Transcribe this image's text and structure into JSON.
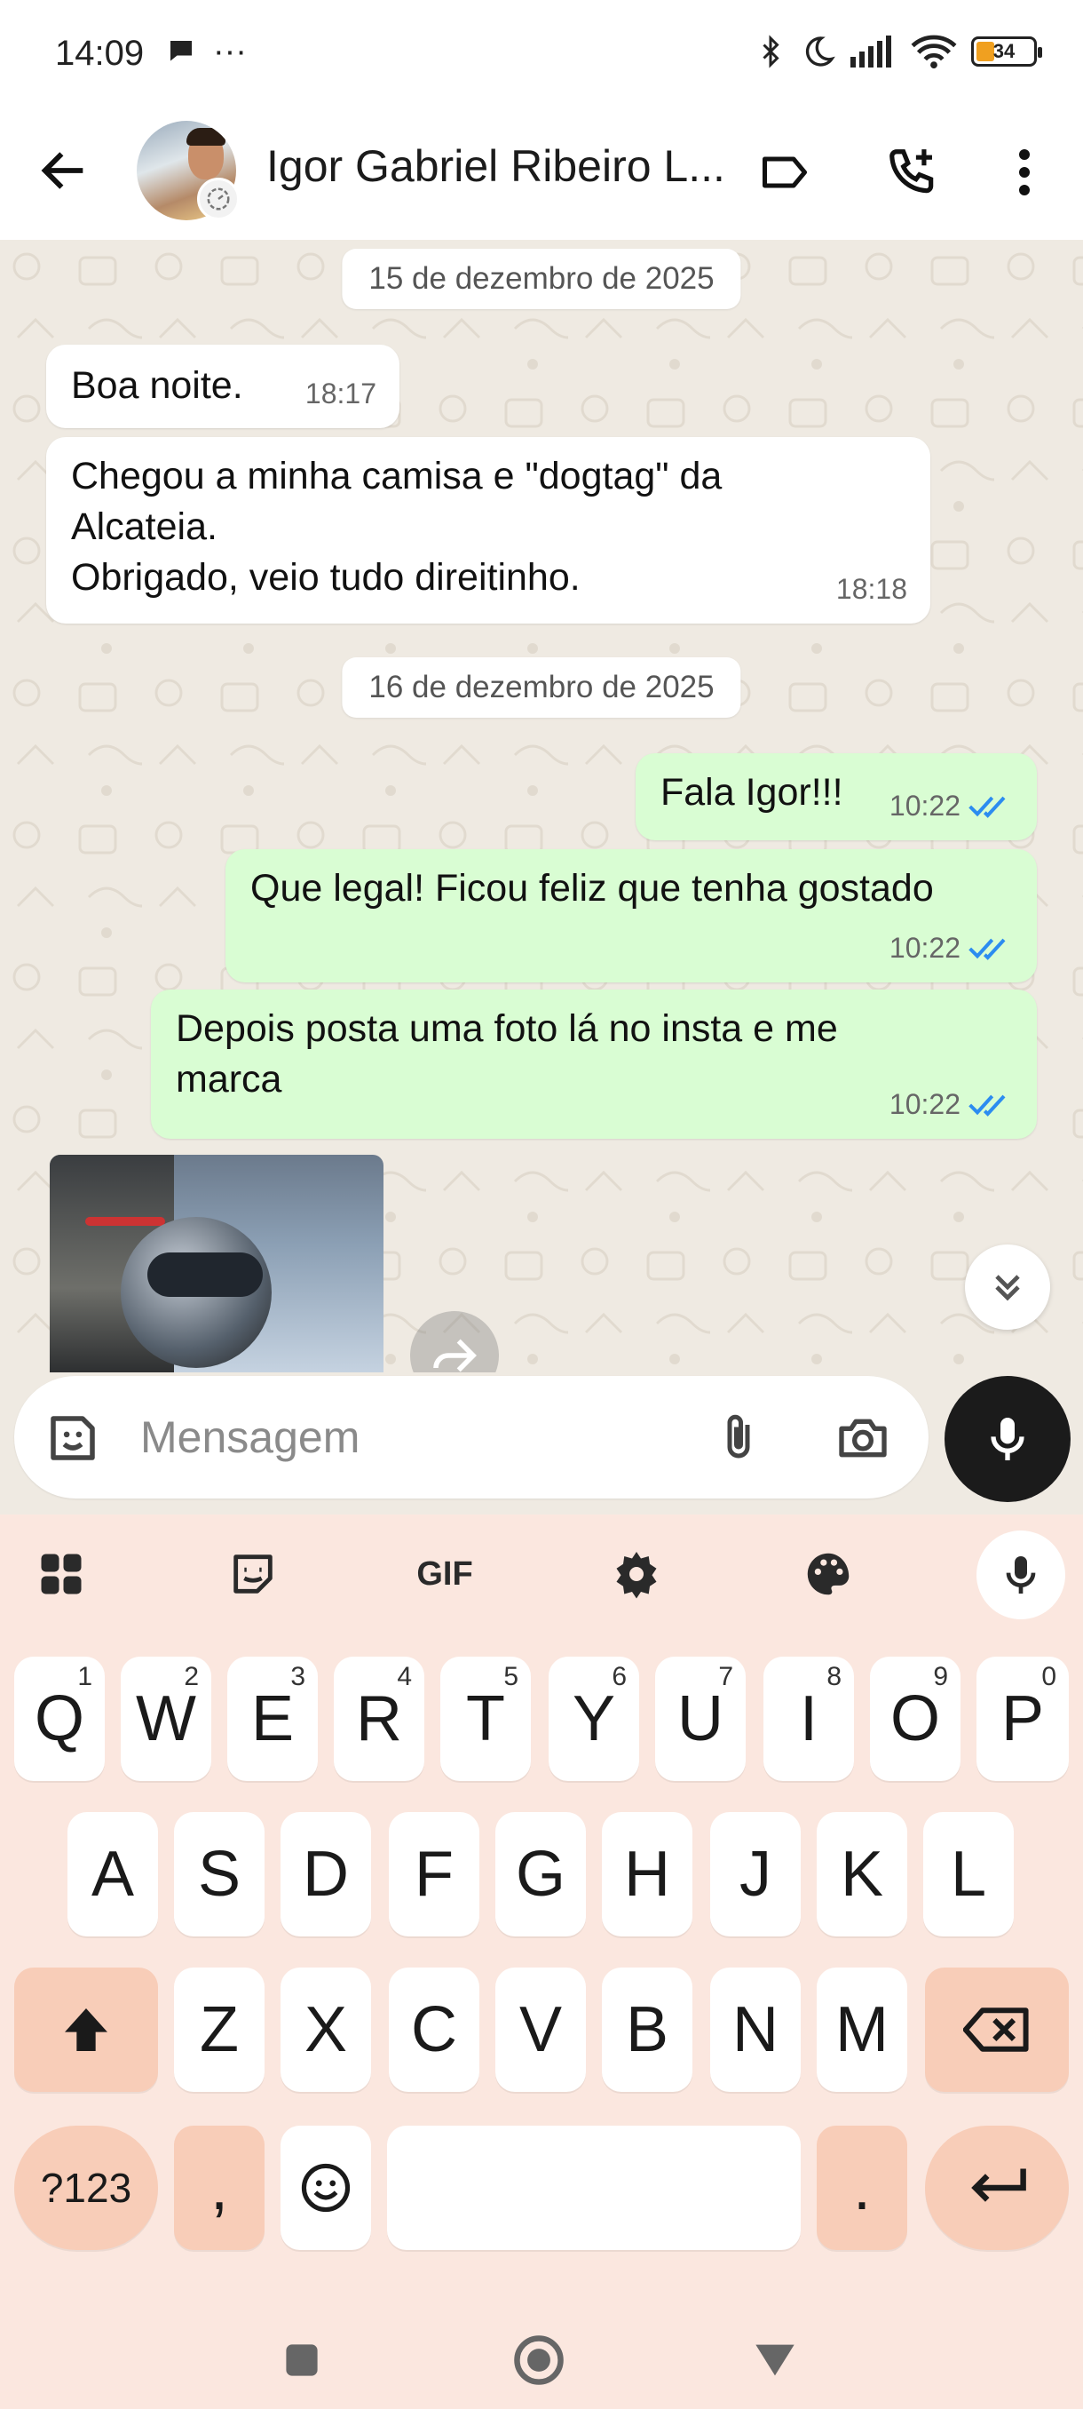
{
  "status_bar": {
    "time": "14:09",
    "more": "···",
    "battery": "34"
  },
  "header": {
    "contact_name": "Igor Gabriel Ribeiro L..."
  },
  "chat": {
    "date_1": "15 de dezembro de 2025",
    "msg_1": {
      "text": "Boa noite.",
      "time": "18:17"
    },
    "msg_2": {
      "text": "Chegou a minha camisa e \"dogtag\" da\nAlcateia.\nObrigado, veio tudo direitinho.",
      "time": "18:18"
    },
    "date_2": "16 de dezembro de 2025",
    "msg_3": {
      "text": "Fala Igor!!!",
      "time": "10:22"
    },
    "msg_4": {
      "text": "Que legal! Ficou feliz que tenha gostado",
      "time": "10:22"
    },
    "msg_5": {
      "text": "Depois posta uma foto lá no insta e me\nmarca",
      "time": "10:22"
    }
  },
  "input": {
    "placeholder": "Mensagem"
  },
  "keyboard": {
    "toolbar_gif": "GIF",
    "row1": [
      {
        "k": "Q",
        "h": "1"
      },
      {
        "k": "W",
        "h": "2"
      },
      {
        "k": "E",
        "h": "3"
      },
      {
        "k": "R",
        "h": "4"
      },
      {
        "k": "T",
        "h": "5"
      },
      {
        "k": "Y",
        "h": "6"
      },
      {
        "k": "U",
        "h": "7"
      },
      {
        "k": "I",
        "h": "8"
      },
      {
        "k": "O",
        "h": "9"
      },
      {
        "k": "P",
        "h": "0"
      }
    ],
    "row2": [
      "A",
      "S",
      "D",
      "F",
      "G",
      "H",
      "J",
      "K",
      "L"
    ],
    "row3": [
      "Z",
      "X",
      "C",
      "V",
      "B",
      "N",
      "M"
    ],
    "symbols": "?123",
    "comma": ",",
    "period": "."
  },
  "colors": {
    "outgoing_bubble": "#d9fdd3",
    "incoming_bubble": "#ffffff",
    "chat_bg": "#efeae2",
    "read_tick": "#2c8cf0",
    "keyboard_bg": "#fbe7df",
    "keyboard_special": "#f8cdb8"
  }
}
